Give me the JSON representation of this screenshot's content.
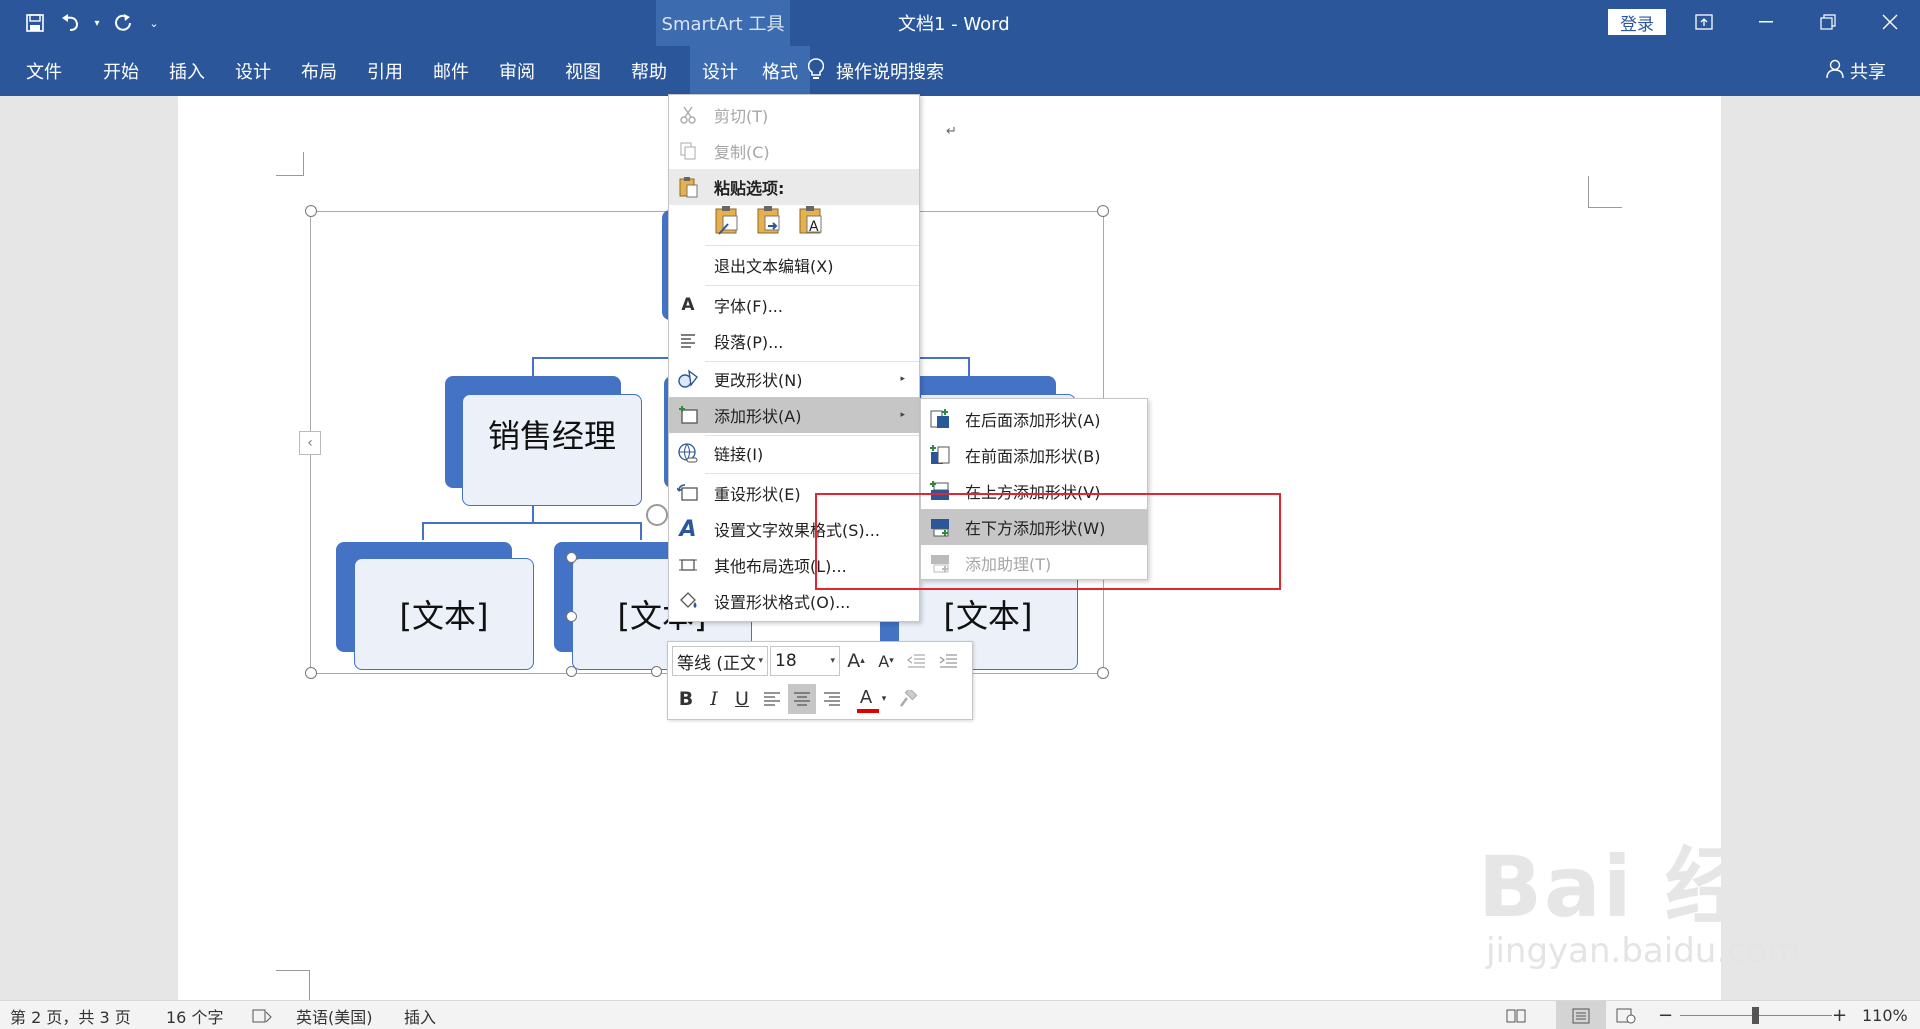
{
  "titlebar": {
    "context_label": "SmartArt 工具",
    "doc_title": "文档1  -  Word",
    "login_label": "登录",
    "colors": {
      "ribbon": "#2b579a",
      "context": "#3d6bb0"
    }
  },
  "menubar": {
    "tabs": [
      "文件",
      "开始",
      "插入",
      "设计",
      "布局",
      "引用",
      "邮件",
      "审阅",
      "视图",
      "帮助"
    ],
    "context_tabs": [
      "设计",
      "格式"
    ],
    "tell_me": "操作说明搜索",
    "share": "共享"
  },
  "smartart": {
    "top_box_text": "销售经理",
    "bottom_box_text": "[文本]"
  },
  "context_menu": {
    "cut": "剪切(T)",
    "copy": "复制(C)",
    "paste_options": "粘贴选项:",
    "exit_edit": "退出文本编辑(X)",
    "font": "字体(F)...",
    "paragraph": "段落(P)...",
    "change_shape": "更改形状(N)",
    "add_shape": "添加形状(A)",
    "link": "链接(I)",
    "reset_shape": "重设形状(E)",
    "text_effects": "设置文字效果格式(S)...",
    "more_layout": "其他布局选项(L)...",
    "format_shape": "设置形状格式(O)..."
  },
  "submenu": {
    "add_after": "在后面添加形状(A)",
    "add_before": "在前面添加形状(B)",
    "add_above": "在上方添加形状(V)",
    "add_below": "在下方添加形状(W)",
    "add_assistant": "添加助理(T)"
  },
  "mini_toolbar": {
    "font_name": "等线 (正文",
    "font_size": "18",
    "font_color": "#e00000"
  },
  "statusbar": {
    "page_info": "第 2 页，共 3 页",
    "word_count": "16 个字",
    "language": "英语(美国)",
    "mode": "插入",
    "zoom": "110%"
  },
  "watermark": {
    "brand": "Bai 经验",
    "url": "jingyan.baidu.com"
  }
}
